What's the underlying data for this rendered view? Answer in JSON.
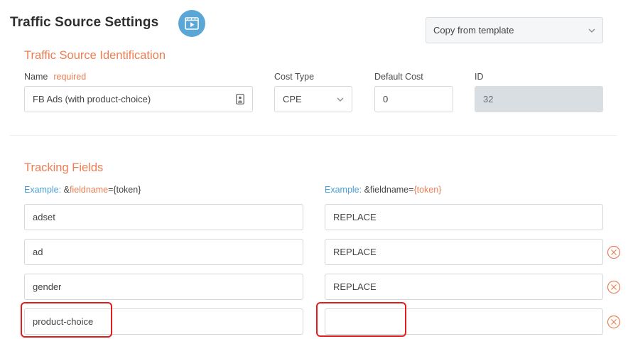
{
  "header": {
    "title": "Traffic Source Settings",
    "template_select": {
      "value": "Copy from template"
    }
  },
  "identification": {
    "section_title": "Traffic Source Identification",
    "name": {
      "label": "Name",
      "required_label": "required",
      "value": "FB Ads (with product-choice)"
    },
    "cost_type": {
      "label": "Cost Type",
      "value": "CPE"
    },
    "default_cost": {
      "label": "Default Cost",
      "value": "0"
    },
    "id": {
      "label": "ID",
      "value": "32"
    }
  },
  "tracking": {
    "section_title": "Tracking Fields",
    "left_example": {
      "label": "Example:",
      "prefix": "&",
      "highlight": "fieldname",
      "suffix": "={token}"
    },
    "right_example": {
      "label": "Example:",
      "prefix": "&fieldname=",
      "highlight": "{token}"
    },
    "rows": [
      {
        "field": "adset",
        "token": "REPLACE"
      },
      {
        "field": "ad",
        "token": "REPLACE"
      },
      {
        "field": "gender",
        "token": "REPLACE"
      },
      {
        "field": "product-choice",
        "token": ""
      }
    ]
  },
  "colors": {
    "accent": "#ec7d52",
    "link": "#4a9fd8",
    "video_button": "#5aa6d6",
    "highlight": "#e31c1c"
  }
}
